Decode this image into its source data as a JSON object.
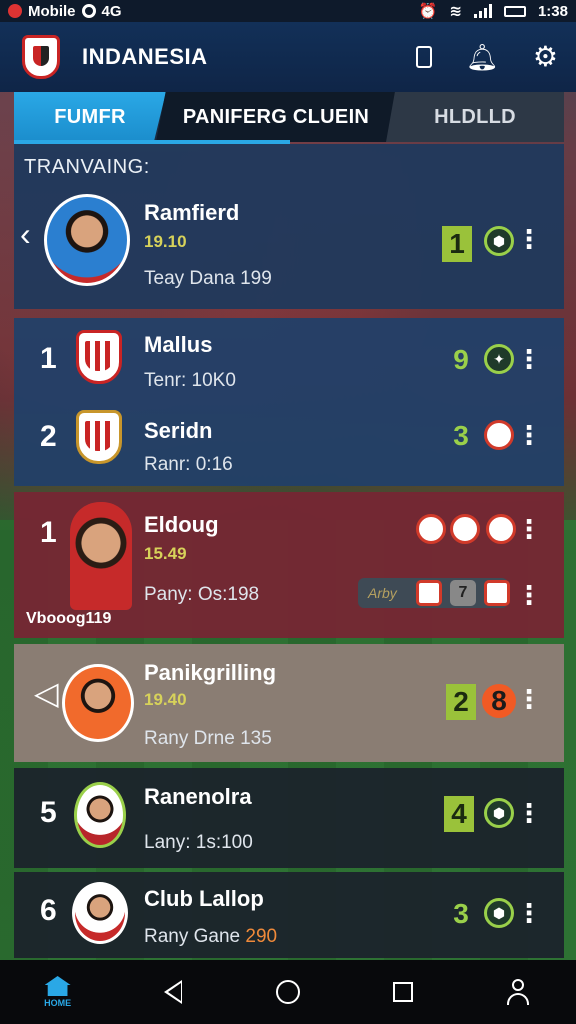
{
  "status_bar": {
    "carrier": "Mobile",
    "sim": "4G",
    "time": "1:38"
  },
  "app_bar": {
    "title": "INDANESIA"
  },
  "tabs": [
    {
      "label": "FUMFR",
      "active": true
    },
    {
      "label": "PANIFERG CLUEIN",
      "active": false
    },
    {
      "label": "HLDLLD",
      "active": false
    }
  ],
  "section": {
    "title": "TRANVAING:"
  },
  "featured": {
    "name": "Ramfierd",
    "value": "19.10",
    "subtitle": "Teay Dana 199",
    "score": "1"
  },
  "cards": [
    {
      "rank": "1",
      "name": "Mallus",
      "subtitle": "Tenr: 10K0",
      "score": "9"
    },
    {
      "rank": "2",
      "name": "Seridn",
      "subtitle": "Ranr: 0:16",
      "score": "3"
    },
    {
      "rank": "1",
      "name": "Eldoug",
      "value": "15.49",
      "subtitle": "Pany: Os:198",
      "watermark": "Vbooog119",
      "pill": "Arby",
      "small_score": "7"
    },
    {
      "name": "Panikgrilling",
      "value": "19.40",
      "subtitle": "Rany Drne 135",
      "score": "2",
      "score2": "8"
    },
    {
      "rank": "5",
      "name": "Ranenolra",
      "subtitle": "Lany: 1s:100",
      "score": "4"
    },
    {
      "rank": "6",
      "name": "Club Lallop",
      "subtitle_prefix": "Rany Gane",
      "subtitle_highlight": "290",
      "score": "3"
    }
  ],
  "bottom_nav": {
    "home_label": "HOME"
  },
  "colors": {
    "accent": "#2aa8e6",
    "score_green": "#9ac23a",
    "maroon": "#762634",
    "beige": "#8d7e76"
  }
}
